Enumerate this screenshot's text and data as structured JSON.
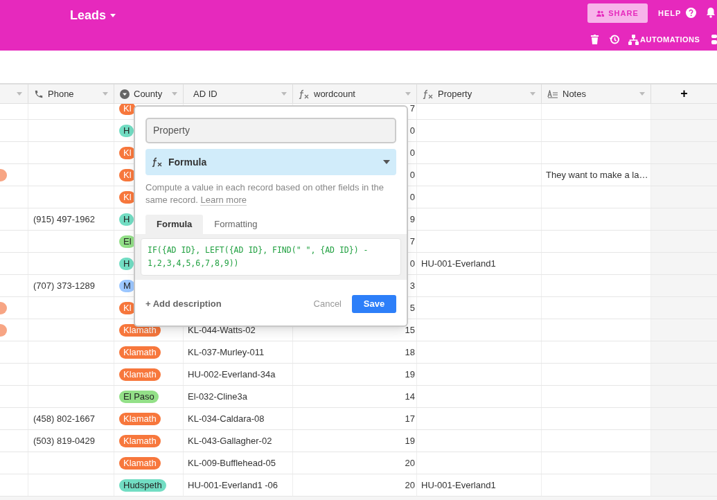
{
  "app_bar": {
    "title": "Leads",
    "share": "SHARE",
    "help": "HELP",
    "automations": "AUTOMATIONS"
  },
  "table": {
    "columns": [
      {
        "kind": "blank"
      },
      {
        "label": "Phone",
        "kind": "phone"
      },
      {
        "label": "County",
        "kind": "select"
      },
      {
        "label": "AD ID",
        "kind": "text"
      },
      {
        "label": "wordcount",
        "kind": "formula"
      },
      {
        "label": "Property",
        "kind": "formula"
      },
      {
        "label": "Notes",
        "kind": "notes"
      }
    ],
    "add_column": "+",
    "rows": [
      {
        "dot": false,
        "phone": "",
        "county": "Kl",
        "color": "#f7773c",
        "ad_id": "",
        "wordcount": "7",
        "property": "",
        "notes": ""
      },
      {
        "dot": false,
        "phone": "",
        "county": "H",
        "color": "#72ddc3",
        "ad_id": "",
        "wordcount": "0",
        "property": "",
        "notes": ""
      },
      {
        "dot": false,
        "phone": "",
        "county": "Kl",
        "color": "#f7773c",
        "ad_id": "",
        "wordcount": "0",
        "property": "",
        "notes": ""
      },
      {
        "dot": true,
        "phone": "",
        "county": "Kl",
        "color": "#f7773c",
        "ad_id": "",
        "wordcount": "0",
        "property": "",
        "notes": "They want to make a la…"
      },
      {
        "dot": false,
        "phone": "",
        "county": "Kl",
        "color": "#f7773c",
        "ad_id": "",
        "wordcount": "0",
        "property": "",
        "notes": ""
      },
      {
        "dot": false,
        "phone": "(915) 497-1962",
        "county": "H",
        "color": "#72ddc3",
        "ad_id": "",
        "wordcount": "9",
        "property": "",
        "notes": ""
      },
      {
        "dot": false,
        "phone": "",
        "county": "El",
        "color": "#93e088",
        "ad_id": "",
        "wordcount": "7",
        "property": "",
        "notes": ""
      },
      {
        "dot": false,
        "phone": "",
        "county": "H",
        "color": "#72ddc3",
        "ad_id": "",
        "wordcount": "0",
        "property": "HU-001-Everland1",
        "notes": ""
      },
      {
        "dot": false,
        "phone": "(707) 373-1289",
        "county": "M",
        "color": "#9cc7ff",
        "ad_id": "",
        "wordcount": "3",
        "property": "",
        "notes": ""
      },
      {
        "dot": true,
        "phone": "",
        "county": "Kl",
        "color": "#f7773c",
        "ad_id": "",
        "wordcount": "5",
        "property": "",
        "notes": ""
      },
      {
        "dot": true,
        "phone": "",
        "county": "Klamath",
        "color": "#f7773c",
        "ad_id": "KL-044-Watts-02",
        "wordcount": "15",
        "property": "",
        "notes": ""
      },
      {
        "dot": false,
        "phone": "",
        "county": "Klamath",
        "color": "#f7773c",
        "ad_id": "KL-037-Murley-011",
        "wordcount": "18",
        "property": "",
        "notes": ""
      },
      {
        "dot": false,
        "phone": "",
        "county": "Klamath",
        "color": "#f7773c",
        "ad_id": "HU-002-Everland-34a",
        "wordcount": "19",
        "property": "",
        "notes": ""
      },
      {
        "dot": false,
        "phone": "",
        "county": "El Paso",
        "color": "#93e088",
        "ad_id": "El-032-Cline3a",
        "wordcount": "14",
        "property": "",
        "notes": ""
      },
      {
        "dot": false,
        "phone": "(458) 802-1667",
        "county": "Klamath",
        "color": "#f7773c",
        "ad_id": "KL-034-Caldara-08",
        "wordcount": "17",
        "property": "",
        "notes": ""
      },
      {
        "dot": false,
        "phone": "(503) 819-0429",
        "county": "Klamath",
        "color": "#f7773c",
        "ad_id": "KL-043-Gallagher-02",
        "wordcount": "19",
        "property": "",
        "notes": ""
      },
      {
        "dot": false,
        "phone": "",
        "county": "Klamath",
        "color": "#f7773c",
        "ad_id": "KL-009-Bufflehead-05",
        "wordcount": "20",
        "property": "",
        "notes": ""
      },
      {
        "dot": false,
        "phone": "",
        "county": "Hudspeth",
        "color": "#72ddc3",
        "ad_id": "HU-001-Everland1 -06",
        "wordcount": "20",
        "property": "HU-001-Everland1",
        "notes": ""
      }
    ]
  },
  "field_dialog": {
    "name": "Property",
    "type": "Formula",
    "description": "Compute a value in each record based on other fields in the same record.",
    "learn_more": "Learn more",
    "tabs": [
      {
        "label": "Formula",
        "selected": true
      },
      {
        "label": "Formatting",
        "selected": false
      }
    ],
    "formula": "IF({AD ID}, LEFT({AD ID}, FIND(\" \", {AD ID}) - 1,2,3,4,5,6,7,8,9))",
    "add_description": "+ Add description",
    "cancel": "Cancel",
    "save": "Save"
  }
}
